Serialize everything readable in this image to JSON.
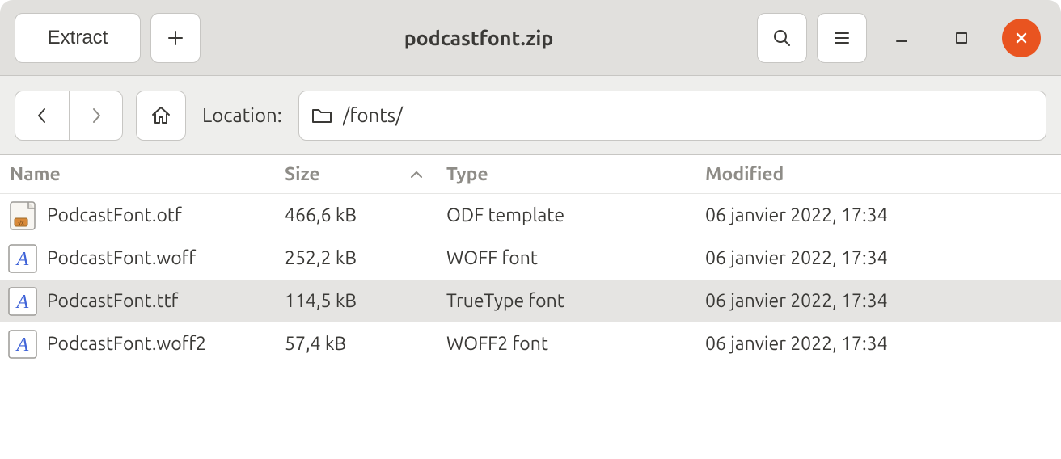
{
  "header": {
    "title": "podcastfont.zip",
    "extract_label": "Extract"
  },
  "toolbar": {
    "location_label": "Location:",
    "location_value": "/fonts/"
  },
  "columns": {
    "name": "Name",
    "size": "Size",
    "type": "Type",
    "modified": "Modified",
    "sorted_by": "size",
    "sort_direction": "ascending"
  },
  "files": [
    {
      "name": "PodcastFont.otf",
      "size": "466,6 kB",
      "type": "ODF template",
      "modified": "06 janvier 2022, 17:34",
      "icon": "template",
      "selected": false
    },
    {
      "name": "PodcastFont.woff",
      "size": "252,2 kB",
      "type": "WOFF font",
      "modified": "06 janvier 2022, 17:34",
      "icon": "font",
      "selected": false
    },
    {
      "name": "PodcastFont.ttf",
      "size": "114,5 kB",
      "type": "TrueType font",
      "modified": "06 janvier 2022, 17:34",
      "icon": "font",
      "selected": true
    },
    {
      "name": "PodcastFont.woff2",
      "size": "57,4 kB",
      "type": "WOFF2 font",
      "modified": "06 janvier 2022, 17:34",
      "icon": "font",
      "selected": false
    }
  ]
}
